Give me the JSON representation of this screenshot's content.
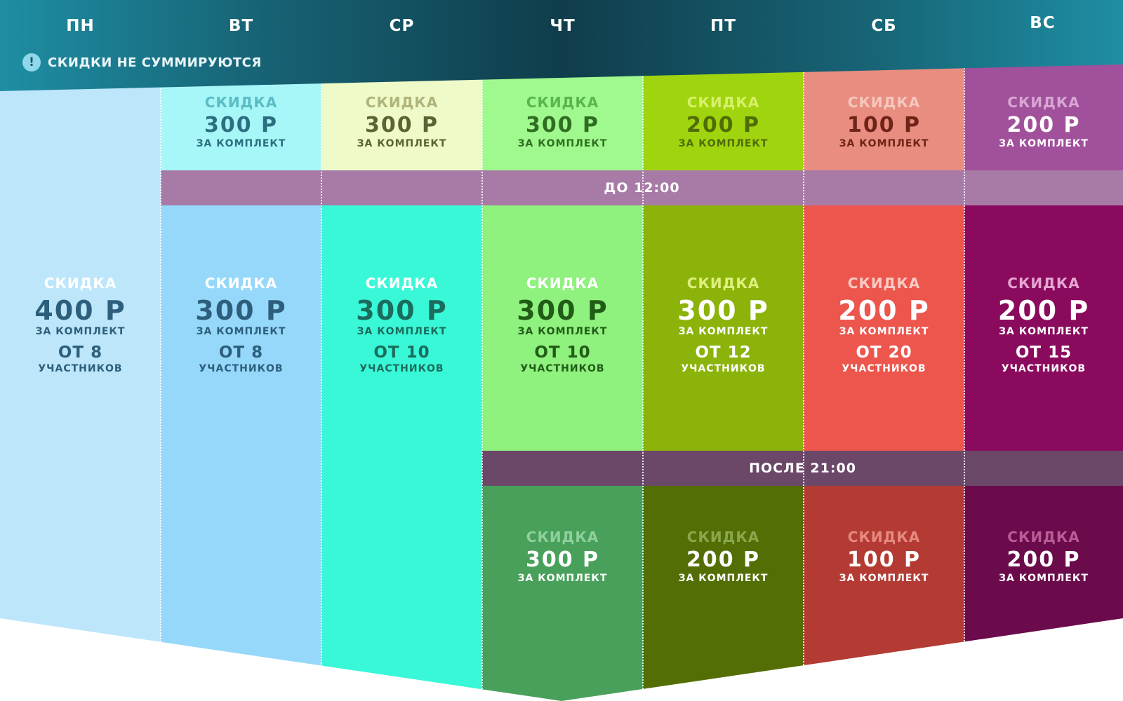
{
  "header": {
    "days": [
      "ПН",
      "ВТ",
      "СР",
      "ЧТ",
      "ПТ",
      "СБ",
      "ВС"
    ],
    "notice_icon": "exclamation-icon",
    "notice_icon_glyph": "!",
    "notice_text": "СКИДКИ НЕ СУММИРУЮТСЯ"
  },
  "bands": {
    "morning_label": "ДО 12:00",
    "evening_label": "ПОСЛЕ 21:00"
  },
  "offers": {
    "morning": [
      null,
      {
        "skidka": "СКИДКА",
        "amount": "300 Р",
        "unit": "ЗА КОМПЛЕКТ"
      },
      {
        "skidka": "СКИДКА",
        "amount": "300 Р",
        "unit": "ЗА КОМПЛЕКТ"
      },
      {
        "skidka": "СКИДКА",
        "amount": "300 Р",
        "unit": "ЗА КОМПЛЕКТ"
      },
      {
        "skidka": "СКИДКА",
        "amount": "200 Р",
        "unit": "ЗА КОМПЛЕКТ"
      },
      {
        "skidka": "СКИДКА",
        "amount": "100 Р",
        "unit": "ЗА КОМПЛЕКТ"
      },
      {
        "skidka": "СКИДКА",
        "amount": "200 Р",
        "unit": "ЗА КОМПЛЕКТ"
      }
    ],
    "group": [
      {
        "skidka": "СКИДКА",
        "amount": "400 Р",
        "unit": "ЗА КОМПЛЕКТ",
        "from": "ОТ 8",
        "participants": "УЧАСТНИКОВ"
      },
      {
        "skidka": "СКИДКА",
        "amount": "300 Р",
        "unit": "ЗА КОМПЛЕКТ",
        "from": "ОТ 8",
        "participants": "УЧАСТНИКОВ"
      },
      {
        "skidka": "СКИДКА",
        "amount": "300 Р",
        "unit": "ЗА КОМПЛЕКТ",
        "from": "ОТ 10",
        "participants": "УЧАСТНИКОВ"
      },
      {
        "skidka": "СКИДКА",
        "amount": "300 Р",
        "unit": "ЗА КОМПЛЕКТ",
        "from": "ОТ 10",
        "participants": "УЧАСТНИКОВ"
      },
      {
        "skidka": "СКИДКА",
        "amount": "300 Р",
        "unit": "ЗА КОМПЛЕКТ",
        "from": "ОТ 12",
        "participants": "УЧАСТНИКОВ"
      },
      {
        "skidka": "СКИДКА",
        "amount": "200 Р",
        "unit": "ЗА КОМПЛЕКТ",
        "from": "ОТ 20",
        "participants": "УЧАСТНИКОВ"
      },
      {
        "skidka": "СКИДКА",
        "amount": "200 Р",
        "unit": "ЗА КОМПЛЕКТ",
        "from": "ОТ 15",
        "participants": "УЧАСТНИКОВ"
      }
    ],
    "evening": [
      null,
      null,
      null,
      {
        "skidka": "СКИДКА",
        "amount": "300 Р",
        "unit": "ЗА КОМПЛЕКТ"
      },
      {
        "skidka": "СКИДКА",
        "amount": "200 Р",
        "unit": "ЗА КОМПЛЕКТ"
      },
      {
        "skidka": "СКИДКА",
        "amount": "100 Р",
        "unit": "ЗА КОМПЛЕКТ"
      },
      {
        "skidka": "СКИДКА",
        "amount": "200 Р",
        "unit": "ЗА КОМПЛЕКТ"
      }
    ]
  },
  "colors": {
    "header_gradient": [
      "#1f8ea3",
      "#176577",
      "#103d4b"
    ],
    "morning_band": "#a87ba6",
    "evening_band": "#6b4868",
    "morning_bg": [
      "",
      "#a8f7f8",
      "#eefac8",
      "#a0f98e",
      "#a0d40e",
      "#e88d7f",
      "#a1509b"
    ],
    "group_bg": [
      "#bde6fb",
      "#96d8fa",
      "#38f8d8",
      "#8ff17e",
      "#8bb309",
      "#ec564d",
      "#8a0a5d"
    ],
    "evening_bg": [
      "",
      "",
      "",
      "#48a05a",
      "#536e04",
      "#b43b34",
      "#6b0b4c"
    ],
    "morning_fg": [
      null,
      {
        "skidka": "#5bbcc4",
        "amount": "#2b6f80",
        "unit": "#2b6f80"
      },
      {
        "skidka": "#b0b47a",
        "amount": "#5c6233",
        "unit": "#5c6233"
      },
      {
        "skidka": "#5ab64c",
        "amount": "#2f6e22",
        "unit": "#2f6e22"
      },
      {
        "skidka": "#d7f06a",
        "amount": "#4f6c06",
        "unit": "#4f6c06"
      },
      {
        "skidka": "#f6c7be",
        "amount": "#6e2418",
        "unit": "#6e2418"
      },
      {
        "skidka": "#d8a6d3",
        "amount": "#ffffff",
        "unit": "#ffffff"
      }
    ],
    "group_fg": [
      {
        "skidka": "#ffffff",
        "amount": "#2d5f7c",
        "unit": "#2d5f7c"
      },
      {
        "skidka": "#ffffff",
        "amount": "#2d5f7c",
        "unit": "#2d5f7c"
      },
      {
        "skidka": "#ffffff",
        "amount": "#1b6c5c",
        "unit": "#1b6c5c"
      },
      {
        "skidka": "#ffffff",
        "amount": "#215c17",
        "unit": "#215c17"
      },
      {
        "skidka": "#dff07e",
        "amount": "#ffffff",
        "unit": "#ffffff"
      },
      {
        "skidka": "#fbc9c2",
        "amount": "#ffffff",
        "unit": "#ffffff"
      },
      {
        "skidka": "#e6a4d1",
        "amount": "#ffffff",
        "unit": "#ffffff"
      }
    ],
    "evening_fg": [
      null,
      null,
      null,
      {
        "skidka": "#8fd09c",
        "amount": "#ffffff",
        "unit": "#ffffff"
      },
      {
        "skidka": "#8aa84c",
        "amount": "#ffffff",
        "unit": "#ffffff"
      },
      {
        "skidka": "#e58a80",
        "amount": "#ffffff",
        "unit": "#ffffff"
      },
      {
        "skidka": "#b85e95",
        "amount": "#ffffff",
        "unit": "#ffffff"
      }
    ]
  }
}
